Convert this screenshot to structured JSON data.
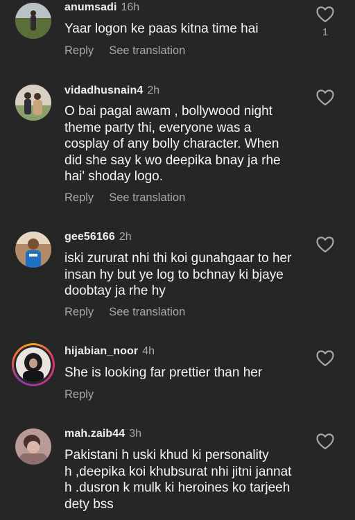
{
  "comments": [
    {
      "username": "anumsadi",
      "time": "16h",
      "text": "Yaar logon ke paas kitna time hai",
      "reply_label": "Reply",
      "translate_label": "See translation",
      "like_count": "1"
    },
    {
      "username": "vidadhusnain4",
      "time": "2h",
      "text": "O bai pagal awam , bollywood night\ntheme party thi, everyone was a\ncosplay of any bolly character.  When\ndid she say k wo deepika bnay ja rhe\nhai' shoday logo.",
      "reply_label": "Reply",
      "translate_label": "See translation"
    },
    {
      "username": "gee56166",
      "time": "2h",
      "text": "iski zururat nhi thi koi gunahgaar to her\ninsan hy but ye log to bchnay ki bjaye\ndoobtay ja rhe hy",
      "reply_label": "Reply",
      "translate_label": "See translation"
    },
    {
      "username": "hijabian_noor",
      "time": "4h",
      "text": "She is looking far prettier than her",
      "reply_label": "Reply"
    },
    {
      "username": "mah.zaib44",
      "time": "3h",
      "text": "Pakistani h uski khud ki personality\nh ,deepika koi khubsurat nhi jitni jannat\nh .dusron k mulk ki heroines ko tarjeeh\ndety bss"
    }
  ],
  "colors": {
    "background": "#262626",
    "primary_text": "#f5f5f5",
    "secondary_text": "#a8a8a8",
    "story_ring": [
      "#f9a825",
      "#e1306c",
      "#833ab4"
    ]
  },
  "icons": {
    "like": "heart-outline-icon"
  }
}
